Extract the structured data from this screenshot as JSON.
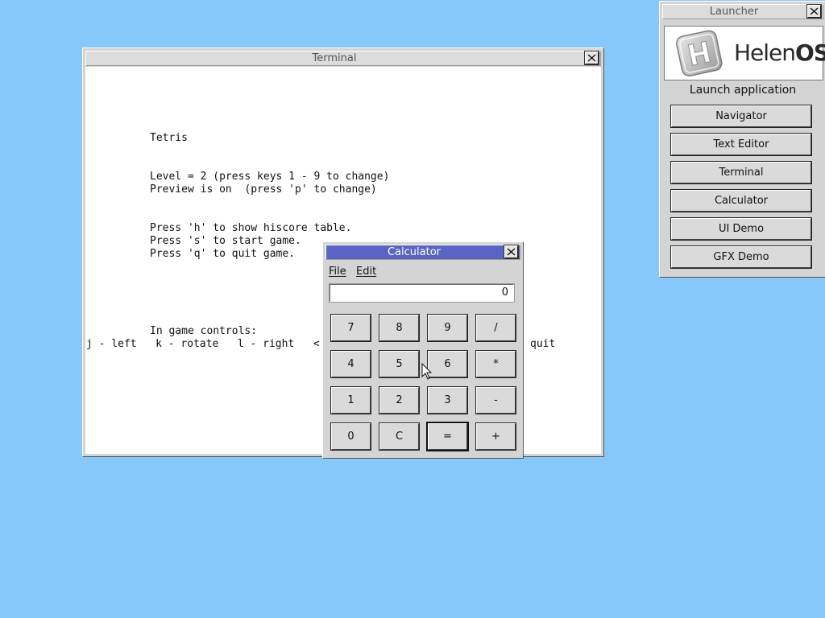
{
  "desktop": {
    "background_color": "#87c8fb"
  },
  "terminal": {
    "title": "Terminal",
    "lines": [
      "Tetris",
      "Level = 2 (press keys 1 - 9 to change)",
      "Preview is on  (press 'p' to change)",
      "Press 'h' to show hiscore table.",
      "Press 's' to start game.",
      "Press 'q' to quit game.",
      "In game controls:",
      "j - left   k - rotate   l - right   <",
      "quit"
    ]
  },
  "calculator": {
    "title": "Calculator",
    "menu": {
      "file_mnemonic": "F",
      "file_rest": "ile",
      "edit_mnemonic": "E",
      "edit_rest": "dit"
    },
    "display_value": "0",
    "buttons": [
      "7",
      "8",
      "9",
      "/",
      "4",
      "5",
      "6",
      "*",
      "1",
      "2",
      "3",
      "-",
      "0",
      "C",
      "=",
      "+"
    ],
    "accent_color": "#5a64c2"
  },
  "launcher": {
    "title": "Launcher",
    "logo": {
      "text_light": "Helen",
      "text_bold": "OS"
    },
    "heading": "Launch application",
    "apps": [
      "Navigator",
      "Text Editor",
      "Terminal",
      "Calculator",
      "UI Demo",
      "GFX Demo"
    ]
  }
}
